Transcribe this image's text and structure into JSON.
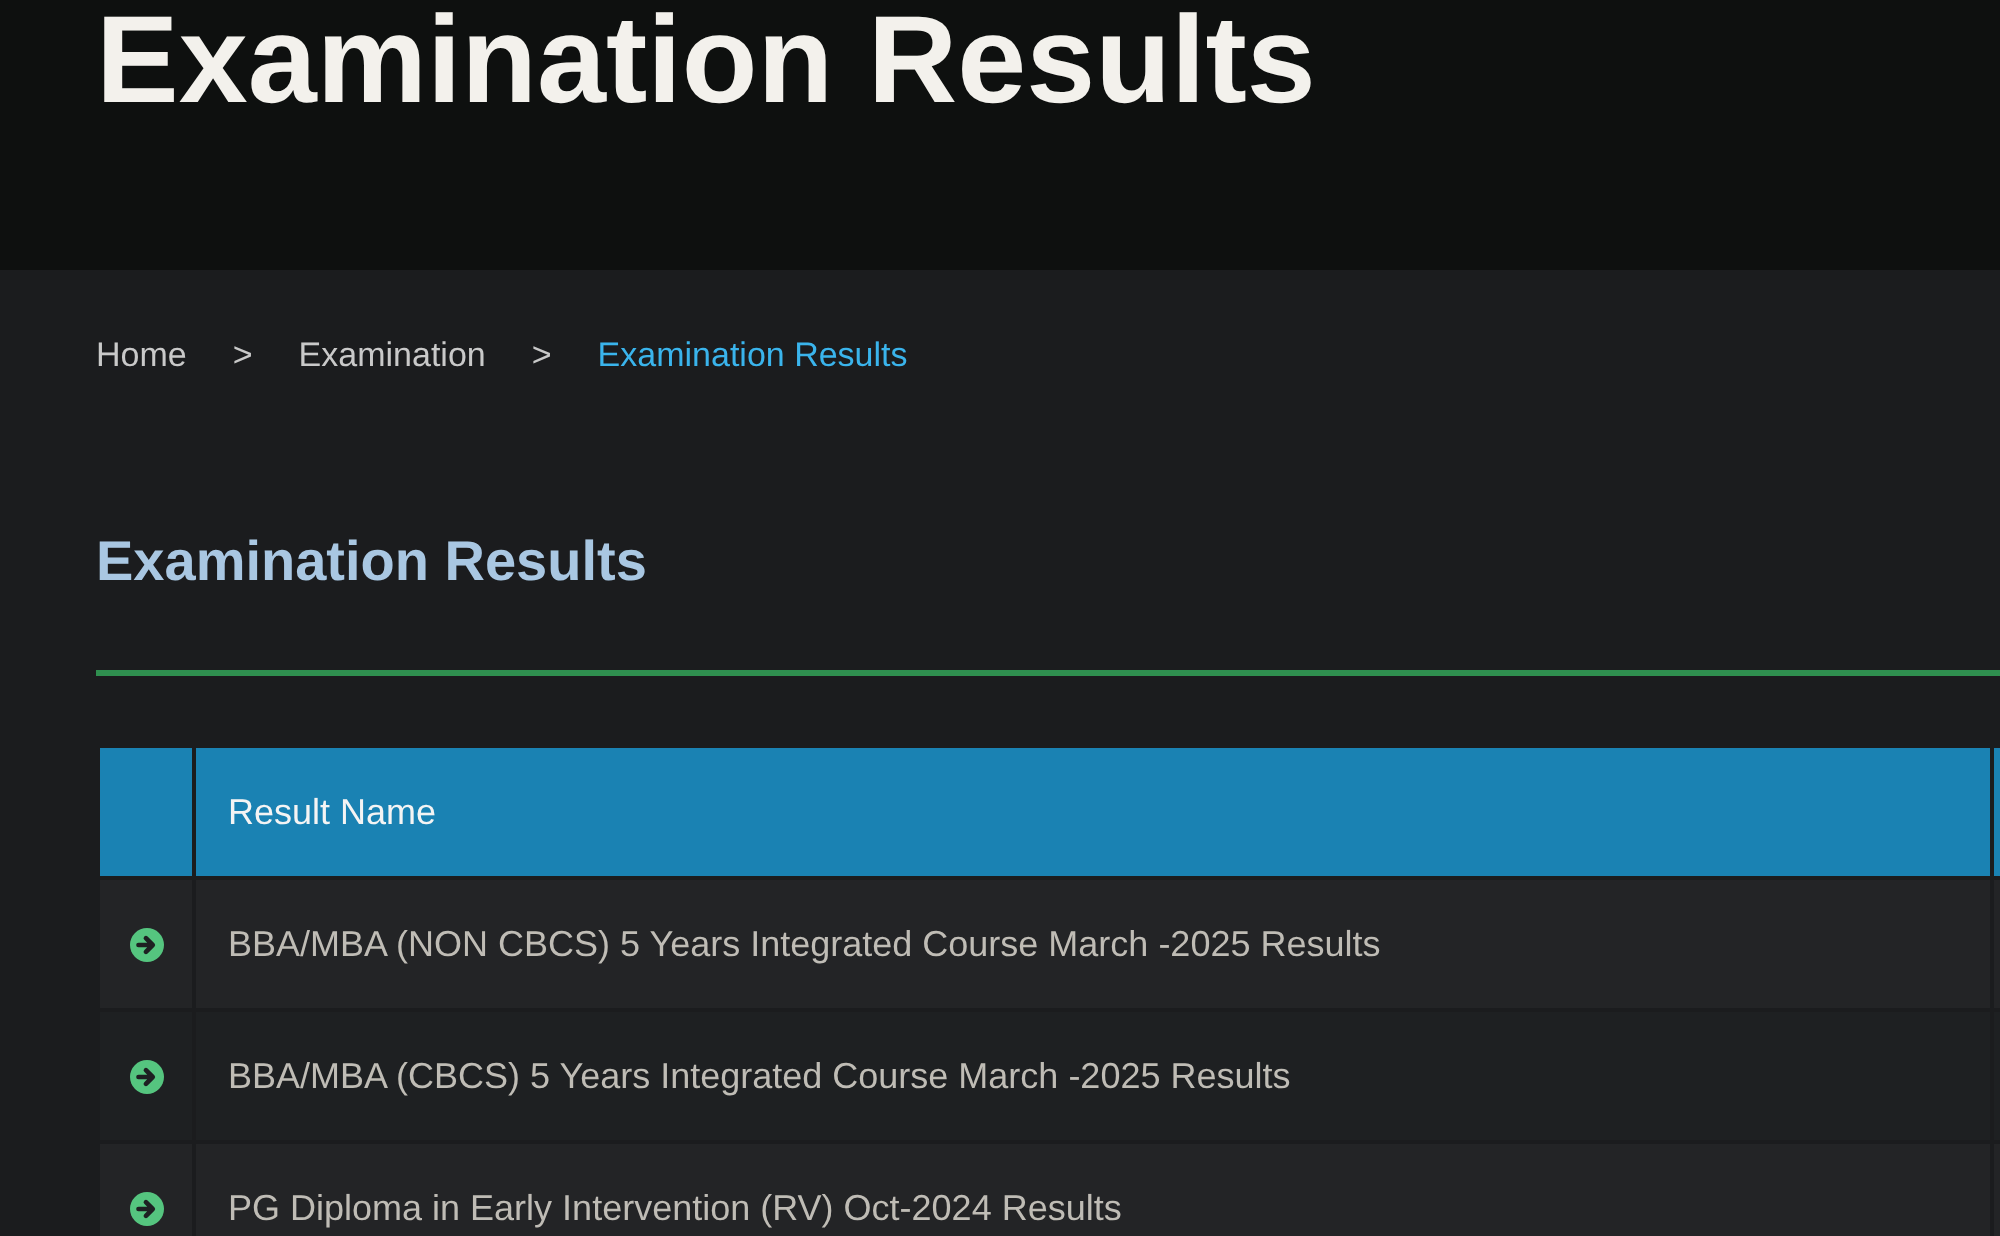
{
  "banner": {
    "title": "Examination Results"
  },
  "breadcrumb": {
    "separator": ">",
    "items": [
      {
        "label": "Home",
        "current": false
      },
      {
        "label": "Examination",
        "current": false
      },
      {
        "label": "Examination Results",
        "current": true
      }
    ]
  },
  "heading": "Examination Results",
  "table": {
    "columns": [
      "Result Name"
    ],
    "rows": [
      {
        "name": "BBA/MBA (NON CBCS) 5 Years Integrated Course March -2025 Results"
      },
      {
        "name": "BBA/MBA (CBCS) 5 Years Integrated Course March -2025 Results"
      },
      {
        "name": "PG Diploma in Early Intervention (RV) Oct-2024 Results"
      }
    ]
  }
}
